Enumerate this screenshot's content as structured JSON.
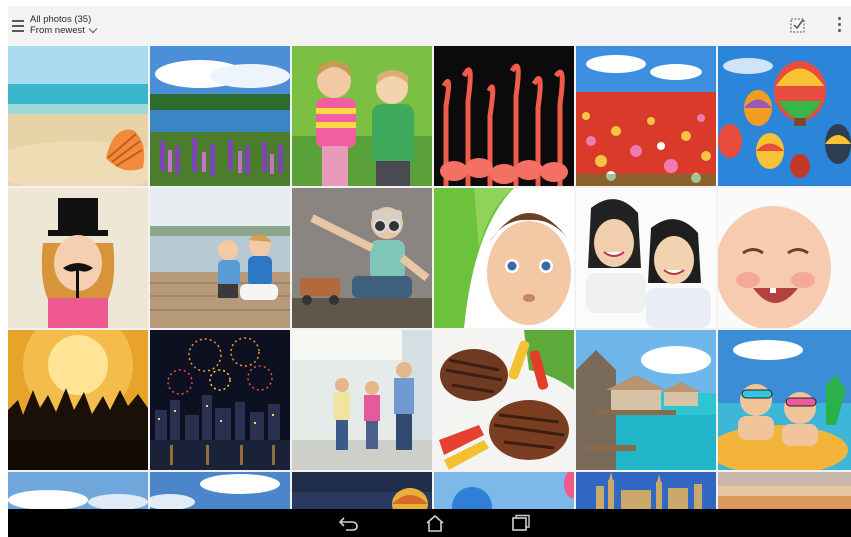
{
  "header": {
    "album_title": "All photos (35)",
    "sort_label": "From newest",
    "menu_icon": "hamburger-menu-icon",
    "select_icon": "select-checkbox-icon",
    "more_icon": "more-vert-icon"
  },
  "grid": {
    "rows_visible": 4,
    "cols": 6,
    "photos": [
      {
        "id": "beach-shell"
      },
      {
        "id": "lake-lupines"
      },
      {
        "id": "toddlers-kissing"
      },
      {
        "id": "flamingos"
      },
      {
        "id": "tulip-field"
      },
      {
        "id": "hot-air-balloons"
      },
      {
        "id": "girl-top-hat"
      },
      {
        "id": "mother-child-dock"
      },
      {
        "id": "boy-aviator"
      },
      {
        "id": "baby-green-towel"
      },
      {
        "id": "two-girls"
      },
      {
        "id": "laughing-baby"
      },
      {
        "id": "concert-crowd"
      },
      {
        "id": "fireworks-city"
      },
      {
        "id": "family-walking"
      },
      {
        "id": "grilled-meat"
      },
      {
        "id": "overwater-villas"
      },
      {
        "id": "kids-pool-goggles"
      },
      {
        "id": "sky-partial-1"
      },
      {
        "id": "sky-partial-2"
      },
      {
        "id": "balloon-partial"
      },
      {
        "id": "sky-balloon-partial"
      },
      {
        "id": "cathedral-partial"
      },
      {
        "id": "sunset-partial"
      }
    ]
  },
  "navbar": {
    "back_icon": "back-arrow-icon",
    "home_icon": "home-icon",
    "recents_icon": "recent-apps-icon"
  },
  "colors": {
    "topbar_bg": "#f3f3f3",
    "navbar_bg": "#000000",
    "text": "#2a2a2a"
  }
}
